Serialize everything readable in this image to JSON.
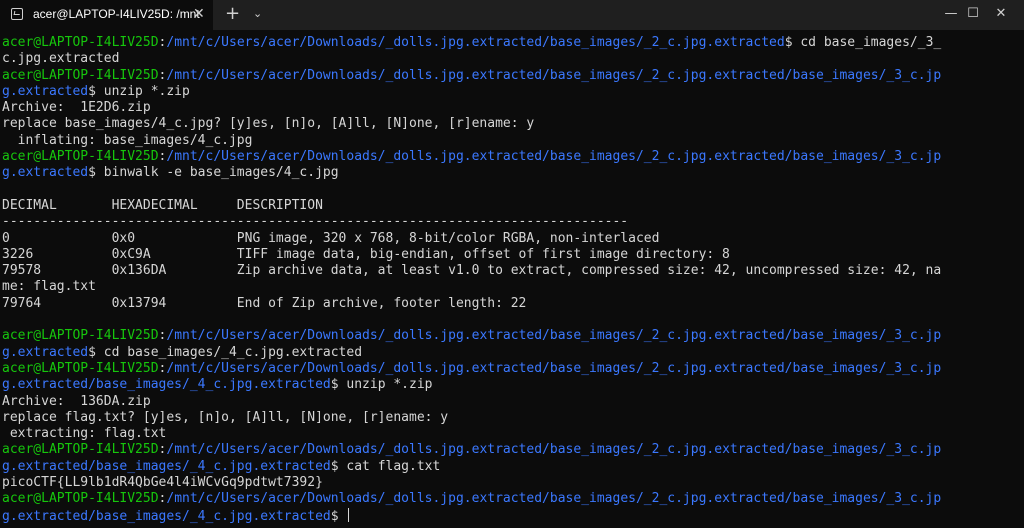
{
  "window": {
    "tab_title": "acer@LAPTOP-I4LIV25D: /mnt",
    "tab_close": "✕",
    "new_tab": "+",
    "dropdown": "⌄",
    "minimize": "—",
    "maximize": "☐",
    "close": "✕"
  },
  "colors": {
    "user": "#16c60c",
    "path": "#3b78ff",
    "text": "#d6d6d6",
    "background": "#0c0c0c"
  },
  "terminal": {
    "lines": [
      {
        "segments": [
          {
            "c": "g",
            "t": "acer@LAPTOP-I4LIV25D"
          },
          {
            "c": "w",
            "t": ":"
          },
          {
            "c": "b",
            "t": "/mnt/c/Users/acer/Downloads/_dolls.jpg.extracted/base_images/_2_c.jpg.extracted"
          },
          {
            "c": "w",
            "t": "$ cd base_images/_3_"
          }
        ]
      },
      {
        "segments": [
          {
            "c": "w",
            "t": "c.jpg.extracted"
          }
        ]
      },
      {
        "segments": [
          {
            "c": "g",
            "t": "acer@LAPTOP-I4LIV25D"
          },
          {
            "c": "w",
            "t": ":"
          },
          {
            "c": "b",
            "t": "/mnt/c/Users/acer/Downloads/_dolls.jpg.extracted/base_images/_2_c.jpg.extracted/base_images/_3_c.jp"
          }
        ]
      },
      {
        "segments": [
          {
            "c": "b",
            "t": "g.extracted"
          },
          {
            "c": "w",
            "t": "$ unzip *.zip"
          }
        ]
      },
      {
        "segments": [
          {
            "c": "w",
            "t": "Archive:  1E2D6.zip"
          }
        ]
      },
      {
        "segments": [
          {
            "c": "w",
            "t": "replace base_images/4_c.jpg? [y]es, [n]o, [A]ll, [N]one, [r]ename: y"
          }
        ]
      },
      {
        "segments": [
          {
            "c": "w",
            "t": "  inflating: base_images/4_c.jpg"
          }
        ]
      },
      {
        "segments": [
          {
            "c": "g",
            "t": "acer@LAPTOP-I4LIV25D"
          },
          {
            "c": "w",
            "t": ":"
          },
          {
            "c": "b",
            "t": "/mnt/c/Users/acer/Downloads/_dolls.jpg.extracted/base_images/_2_c.jpg.extracted/base_images/_3_c.jp"
          }
        ]
      },
      {
        "segments": [
          {
            "c": "b",
            "t": "g.extracted"
          },
          {
            "c": "w",
            "t": "$ binwalk -e base_images/4_c.jpg"
          }
        ]
      },
      {
        "segments": [
          {
            "c": "w",
            "t": ""
          }
        ]
      },
      {
        "segments": [
          {
            "c": "w",
            "t": "DECIMAL       HEXADECIMAL     DESCRIPTION"
          }
        ]
      },
      {
        "segments": [
          {
            "c": "w",
            "t": "--------------------------------------------------------------------------------"
          }
        ]
      },
      {
        "segments": [
          {
            "c": "w",
            "t": "0             0x0             PNG image, 320 x 768, 8-bit/color RGBA, non-interlaced"
          }
        ]
      },
      {
        "segments": [
          {
            "c": "w",
            "t": "3226          0xC9A           TIFF image data, big-endian, offset of first image directory: 8"
          }
        ]
      },
      {
        "segments": [
          {
            "c": "w",
            "t": "79578         0x136DA         Zip archive data, at least v1.0 to extract, compressed size: 42, uncompressed size: 42, na"
          }
        ]
      },
      {
        "segments": [
          {
            "c": "w",
            "t": "me: flag.txt"
          }
        ]
      },
      {
        "segments": [
          {
            "c": "w",
            "t": "79764         0x13794         End of Zip archive, footer length: 22"
          }
        ]
      },
      {
        "segments": [
          {
            "c": "w",
            "t": ""
          }
        ]
      },
      {
        "segments": [
          {
            "c": "g",
            "t": "acer@LAPTOP-I4LIV25D"
          },
          {
            "c": "w",
            "t": ":"
          },
          {
            "c": "b",
            "t": "/mnt/c/Users/acer/Downloads/_dolls.jpg.extracted/base_images/_2_c.jpg.extracted/base_images/_3_c.jp"
          }
        ]
      },
      {
        "segments": [
          {
            "c": "b",
            "t": "g.extracted"
          },
          {
            "c": "w",
            "t": "$ cd base_images/_4_c.jpg.extracted"
          }
        ]
      },
      {
        "segments": [
          {
            "c": "g",
            "t": "acer@LAPTOP-I4LIV25D"
          },
          {
            "c": "w",
            "t": ":"
          },
          {
            "c": "b",
            "t": "/mnt/c/Users/acer/Downloads/_dolls.jpg.extracted/base_images/_2_c.jpg.extracted/base_images/_3_c.jp"
          }
        ]
      },
      {
        "segments": [
          {
            "c": "b",
            "t": "g.extracted/base_images/_4_c.jpg.extracted"
          },
          {
            "c": "w",
            "t": "$ unzip *.zip"
          }
        ]
      },
      {
        "segments": [
          {
            "c": "w",
            "t": "Archive:  136DA.zip"
          }
        ]
      },
      {
        "segments": [
          {
            "c": "w",
            "t": "replace flag.txt? [y]es, [n]o, [A]ll, [N]one, [r]ename: y"
          }
        ]
      },
      {
        "segments": [
          {
            "c": "w",
            "t": " extracting: flag.txt"
          }
        ]
      },
      {
        "segments": [
          {
            "c": "g",
            "t": "acer@LAPTOP-I4LIV25D"
          },
          {
            "c": "w",
            "t": ":"
          },
          {
            "c": "b",
            "t": "/mnt/c/Users/acer/Downloads/_dolls.jpg.extracted/base_images/_2_c.jpg.extracted/base_images/_3_c.jp"
          }
        ]
      },
      {
        "segments": [
          {
            "c": "b",
            "t": "g.extracted/base_images/_4_c.jpg.extracted"
          },
          {
            "c": "w",
            "t": "$ cat flag.txt"
          }
        ]
      },
      {
        "segments": [
          {
            "c": "w",
            "t": "picoCTF{LL9lb1dR4QbGe4l4iWCvGq9pdtwt7392}"
          }
        ]
      },
      {
        "segments": [
          {
            "c": "g",
            "t": "acer@LAPTOP-I4LIV25D"
          },
          {
            "c": "w",
            "t": ":"
          },
          {
            "c": "b",
            "t": "/mnt/c/Users/acer/Downloads/_dolls.jpg.extracted/base_images/_2_c.jpg.extracted/base_images/_3_c.jp"
          }
        ]
      },
      {
        "segments": [
          {
            "c": "b",
            "t": "g.extracted/base_images/_4_c.jpg.extracted"
          },
          {
            "c": "w",
            "t": "$ "
          }
        ],
        "cursor": true
      }
    ]
  }
}
